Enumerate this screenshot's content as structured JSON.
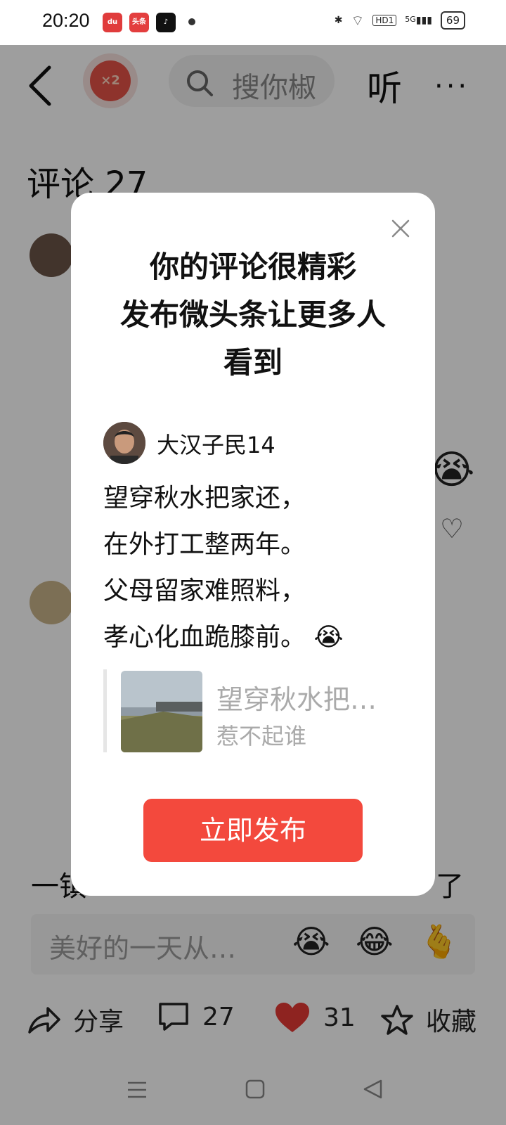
{
  "status_bar": {
    "time": "20:20",
    "apps": [
      "baidu-icon",
      "toutiao-icon",
      "tiktok-icon"
    ],
    "toutiao_label": "头条",
    "network": "5G",
    "hd": "HD1",
    "battery": "69"
  },
  "nav": {
    "badge": "×2",
    "search_placeholder": "搜你椒",
    "listen": "听",
    "more": "···"
  },
  "comments": {
    "title": "评论 27",
    "bottom_preview_left": "一镇",
    "bottom_preview_right": "了"
  },
  "reply": {
    "placeholder": "美好的一天从…",
    "emojis": [
      "😭",
      "😂",
      "🫰"
    ]
  },
  "actions": {
    "share": "分享",
    "comments": "27",
    "likes": "31",
    "favorite": "收藏"
  },
  "dialog": {
    "title_lines": [
      "你的评论很精彩",
      "发布微头条让更多人",
      "看到"
    ],
    "username": "大汉子民14",
    "poem_lines": [
      "望穿秋水把家还，",
      "在外打工整两年。",
      "父母留家难照料，",
      "孝心化血跪膝前。"
    ],
    "poem_emoji": "😭",
    "quote_title": "望穿秋水把…",
    "quote_author": "惹不起谁",
    "publish_label": "立即发布"
  },
  "colors": {
    "accent": "#f3493d",
    "overlay": "rgba(0,0,0,0.38)"
  }
}
